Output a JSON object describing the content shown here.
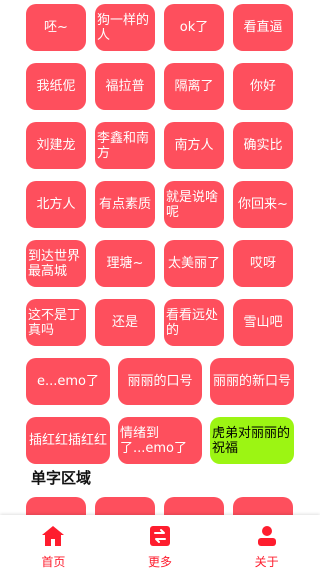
{
  "grid4_buttons": [
    {
      "label": "呸~",
      "style": "center"
    },
    {
      "label": "狗一样的人",
      "style": "left"
    },
    {
      "label": "ok了",
      "style": "center"
    },
    {
      "label": "看直逼",
      "style": "center"
    },
    {
      "label": "我纸伲",
      "style": "center"
    },
    {
      "label": "福拉普",
      "style": "center"
    },
    {
      "label": "隔离了",
      "style": "center"
    },
    {
      "label": "你好",
      "style": "center"
    },
    {
      "label": "刘建龙",
      "style": "center"
    },
    {
      "label": "李鑫和南方",
      "style": "left"
    },
    {
      "label": "南方人",
      "style": "center"
    },
    {
      "label": "确实比",
      "style": "center"
    },
    {
      "label": "北方人",
      "style": "center"
    },
    {
      "label": "有点素质",
      "style": "center"
    },
    {
      "label": "就是说啥呢",
      "style": "left"
    },
    {
      "label": "你回来~",
      "style": "center"
    },
    {
      "label": "到达世界最高城",
      "style": "left"
    },
    {
      "label": "理塘~",
      "style": "center"
    },
    {
      "label": "太美丽了",
      "style": "center"
    },
    {
      "label": "哎呀",
      "style": "center"
    },
    {
      "label": "这不是丁真吗",
      "style": "left"
    },
    {
      "label": "还是",
      "style": "center"
    },
    {
      "label": "看看远处的",
      "style": "left"
    },
    {
      "label": "雪山吧",
      "style": "center"
    }
  ],
  "grid3_buttons": [
    {
      "label": "e...emo了",
      "style": "center"
    },
    {
      "label": "丽丽的口号",
      "style": "center"
    },
    {
      "label": "丽丽的新口号",
      "style": "center"
    },
    {
      "label": "插红红插红红",
      "style": "center"
    },
    {
      "label": "情绪到了...emo了",
      "style": "left"
    },
    {
      "label": "虎弟对丽丽的祝福",
      "style": "left",
      "highlight": "#9cf513"
    }
  ],
  "section_title": "单字区域",
  "partial_buttons": [
    "",
    "",
    "",
    ""
  ],
  "nav": {
    "home": "首页",
    "more": "更多",
    "about": "关于",
    "accent": "#fe1d2e"
  },
  "colors": {
    "button": "#fe4f5d",
    "highlight": "#9cf513"
  }
}
